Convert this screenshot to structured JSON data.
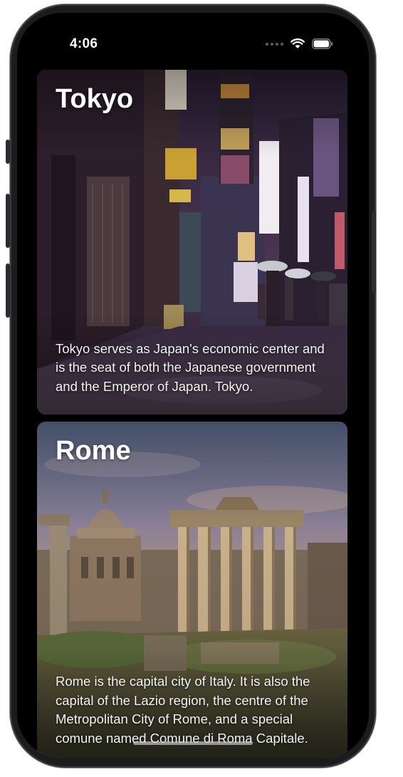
{
  "status_bar": {
    "time": "4:06"
  },
  "cards": [
    {
      "title": "Tokyo",
      "description": "Tokyo serves as Japan's economic center and is the seat of both the Japanese government and the Emperor of Japan. Tokyo."
    },
    {
      "title": "Rome",
      "description": "Rome is the capital city of Italy. It is also the capital of the Lazio region, the centre of the Metropolitan City of Rome, and a special comune named Comune di Roma Capitale."
    }
  ],
  "icons": {
    "wifi": "wifi-icon",
    "battery": "battery-icon",
    "signal": "cellular-signal-icon"
  }
}
